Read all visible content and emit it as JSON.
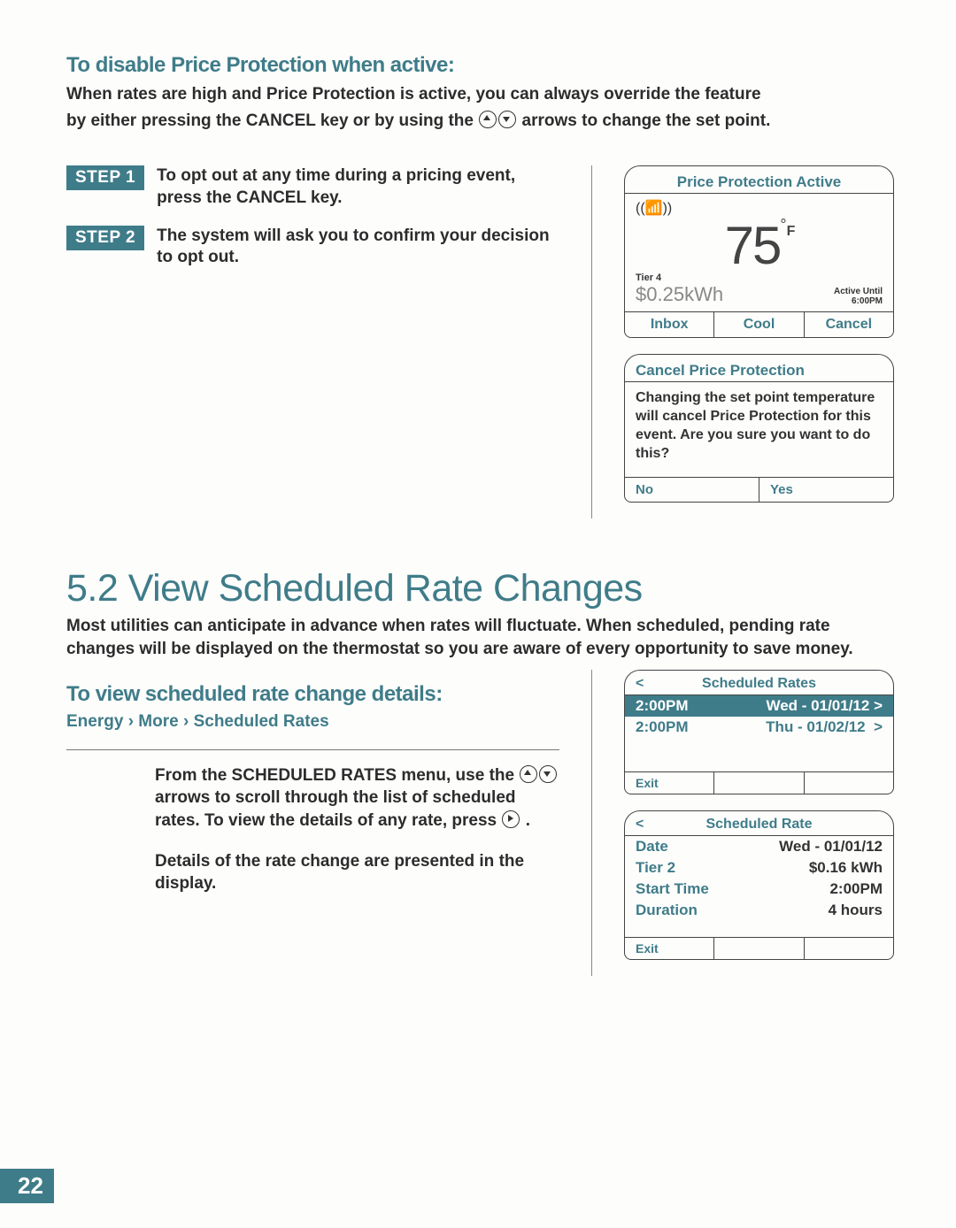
{
  "section1": {
    "heading": "To disable Price Protection when active:",
    "intro_line1": "When rates are high and Price Protection is active, you can always override the feature",
    "intro_line2_a": "by either pressing the CANCEL key or by using the ",
    "intro_line2_b": " arrows to change the set point.",
    "steps": [
      {
        "badge": "STEP 1",
        "text": "To opt out at any time during a pricing event, press the CANCEL key."
      },
      {
        "badge": "STEP 2",
        "text": "The system will ask you to confirm your decision to opt out."
      }
    ]
  },
  "thermo_panel": {
    "title": "Price Protection Active",
    "temp": "75",
    "deg": "°",
    "unit": "F",
    "tier": "Tier 4",
    "price": "$0.25",
    "price_unit": "kWh",
    "active_label": "Active Until",
    "active_value": "6:00PM",
    "buttons": [
      "Inbox",
      "Cool",
      "Cancel"
    ]
  },
  "cancel_panel": {
    "title": "Cancel Price Protection",
    "body": "Changing the set point temperature will cancel Price Protection for this event. Are you sure you want to do this?",
    "buttons": [
      "No",
      "Yes"
    ]
  },
  "section2": {
    "title": "5.2 View Scheduled Rate Changes",
    "intro": "Most utilities can anticipate in advance when rates will fluctuate. When scheduled, pending rate changes will be displayed on the thermostat so you are aware of every opportunity to save money.",
    "subhead": "To view scheduled rate change details:",
    "breadcrumb": "Energy › More › Scheduled Rates",
    "para1_a": "From the SCHEDULED RATES menu, use the ",
    "para1_b": " arrows to scroll through the list of scheduled rates. To view the details of any rate, press ",
    "para1_c": " .",
    "para2": "Details of the rate change are presented in the display."
  },
  "rates_list": {
    "title": "Scheduled Rates",
    "back": "<",
    "rows": [
      {
        "time": "2:00PM",
        "date": "Wed - 01/01/12",
        "arrow": ">",
        "selected": true
      },
      {
        "time": "2:00PM",
        "date": "Thu - 01/02/12",
        "arrow": ">",
        "selected": false
      }
    ],
    "exit": "Exit"
  },
  "rate_detail": {
    "title": "Scheduled Rate",
    "back": "<",
    "rows": [
      {
        "label": "Date",
        "value": "Wed - 01/01/12"
      },
      {
        "label": "Tier 2",
        "value": "$0.16 kWh"
      },
      {
        "label": "Start Time",
        "value": "2:00PM"
      },
      {
        "label": "Duration",
        "value": "4 hours"
      }
    ],
    "exit": "Exit"
  },
  "page_number": "22"
}
